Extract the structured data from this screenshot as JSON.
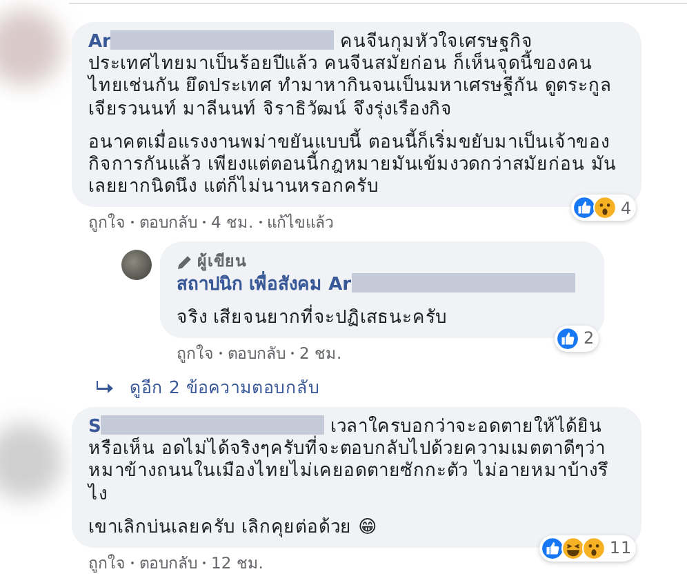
{
  "comments": [
    {
      "author": "Ar",
      "paragraphs": [
        "คนจีนกุมหัวใจเศรษฐกิจประเทศไทยมาเป็นร้อยปีแล้ว คนจีนสมัยก่อน ก็เห็นจุดนี้ของคนไทยเช่นกัน ยึดประเทศ ทำมาหากินจนเป็นมหาเศรษฐีกัน ดูตระกูลเจียรวนนท์ มาลีนนท์ จิราธิวัฒน์ จึงรุ่งเรืองกิจ",
        "อนาคตเมื่อแรงงานพม่าขยันแบบนี้ ตอนนี้ก็เริ่มขยับมาเป็นเจ้าของกิจการกันแล้ว เพียงแต่ตอนนี้กฎหมายมันเข้มงวดกว่าสมัยก่อน มันเลยยากนิดนึง แต่ก็ไม่นานหรอกครับ"
      ],
      "reactions": [
        {
          "kind": "like"
        },
        {
          "kind": "wow"
        }
      ],
      "reaction_count": "4",
      "actions": [
        "ถูกใจ",
        "ตอบกลับ",
        "4 ชม.",
        "แก้ไขแล้ว"
      ],
      "replies": [
        {
          "badge": "ผู้เขียน",
          "author": "สถาปนิก เพื่อสังคม",
          "tag": "Ar",
          "paragraphs": [
            "จริง เสียจนยากที่จะปฏิเสธนะครับ"
          ],
          "reactions": [
            {
              "kind": "like"
            }
          ],
          "reaction_count": "2",
          "actions": [
            "ถูกใจ",
            "ตอบกลับ",
            "2 ชม."
          ]
        }
      ],
      "more_replies": "ดูอีก 2 ข้อความตอบกลับ"
    },
    {
      "author": "S",
      "paragraphs": [
        "เวลาใครบอกว่าจะอดตายให้ได้ยินหรือเห็น อดไม่ได้จริงๆครับที่จะตอบกลับไปด้วยความเมตตาดีๆว่า หมาข้างถนนในเมืองไทยไม่เคยอดตายซักกะตัว ไม่อายหมาบ้างรึไง",
        "เขาเลิกบ่นเลยครับ เลิกคุยต่อด้วย 😁"
      ],
      "reactions": [
        {
          "kind": "like"
        },
        {
          "kind": "haha"
        },
        {
          "kind": "wow"
        }
      ],
      "reaction_count": "11",
      "actions": [
        "ถูกใจ",
        "ตอบกลับ",
        "12 ชม."
      ]
    }
  ]
}
